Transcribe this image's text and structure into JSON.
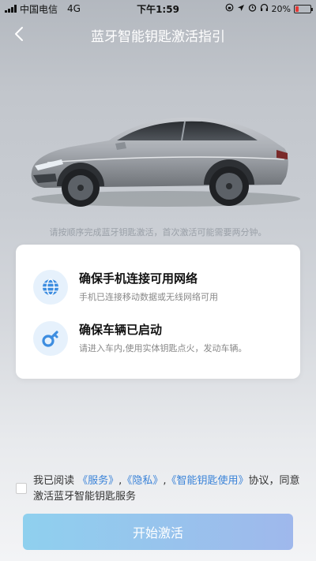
{
  "status_bar": {
    "carrier": "中国电信",
    "network": "4G",
    "time": "下午1:59",
    "battery_percent": "20%",
    "battery_level": 0.2,
    "icons": [
      "lock-rotation-icon",
      "location-icon",
      "alarm-icon",
      "headphones-icon",
      "battery-icon"
    ]
  },
  "nav": {
    "title": "蓝牙智能钥匙激活指引",
    "back_icon": "chevron-left-icon"
  },
  "hero": {
    "image": "car-photo",
    "hint": "请按顺序完成蓝牙钥匙激活，首次激活可能需要两分钟。"
  },
  "steps": [
    {
      "icon": "globe-icon",
      "title": "确保手机连接可用网络",
      "desc": "手机已连接移动数据或无线网络可用"
    },
    {
      "icon": "key-icon",
      "title": "确保车辆已启动",
      "desc": "请进入车内,使用实体钥匙点火，发动车辆。"
    }
  ],
  "agreement": {
    "prefix": "我已阅读",
    "link_service": "《服务》",
    "sep1": ",",
    "link_privacy": "《隐私》",
    "sep2": ",",
    "link_key_usage": "《智能钥匙使用》",
    "suffix": "协议，同意激活蓝牙智能钥匙服务",
    "checked": false
  },
  "action": {
    "start_label": "开始激活"
  },
  "colors": {
    "link": "#3a83d8",
    "icon_bg": "#e6f1fc",
    "icon_fg": "#3d8de0",
    "button_start": "#8fd0ee",
    "button_end": "#9fb8ec"
  }
}
